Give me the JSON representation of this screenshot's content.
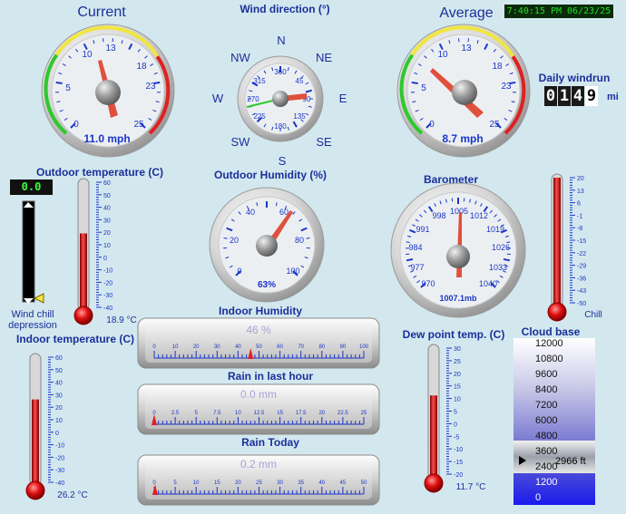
{
  "clock": "7:40:15 PM 06/23/25",
  "current": {
    "title": "Current",
    "readout": "11.0 mph",
    "ticks": [
      "0",
      "5",
      "10",
      "13",
      "18",
      "23",
      "25"
    ]
  },
  "average": {
    "title": "Average",
    "readout": "8.7 mph",
    "ticks": [
      "0",
      "5",
      "10",
      "13",
      "18",
      "23",
      "25"
    ]
  },
  "wind_direction": {
    "title": "Wind direction (°)",
    "compass": {
      "n": "N",
      "ne": "NE",
      "e": "E",
      "se": "SE",
      "s": "S",
      "sw": "SW",
      "w": "W",
      "nw": "NW"
    },
    "ticks": [
      "360",
      "45",
      "90",
      "135",
      "180",
      "225",
      "270",
      "315"
    ]
  },
  "daily_windrun": {
    "title": "Daily windrun",
    "digits": [
      "0",
      "1",
      "4",
      "9"
    ],
    "unit": "mi"
  },
  "outdoor_temp": {
    "title": "Outdoor temperature (C)",
    "readout": "18.9 °C",
    "scale": [
      "60",
      "50",
      "40",
      "30",
      "20",
      "10",
      "0",
      "-10",
      "-20",
      "-30",
      "-40"
    ],
    "value": 18.9
  },
  "wind_chill": {
    "lcd": "0.0",
    "label_line1": "Wind chill",
    "label_line2": "depression"
  },
  "outdoor_humidity": {
    "title": "Outdoor Humidity (%)",
    "readout": "63%",
    "ticks": [
      "0",
      "20",
      "40",
      "60",
      "80",
      "100"
    ]
  },
  "barometer": {
    "title": "Barometer",
    "readout": "1007.1mb",
    "ticks": [
      "970",
      "977",
      "984",
      "991",
      "998",
      "1005",
      "1012",
      "1019",
      "1026",
      "1033",
      "1040"
    ]
  },
  "chill": {
    "label": "Chill",
    "scale": [
      "20",
      "13",
      "6",
      "-1",
      "-8",
      "-15",
      "-22",
      "-29",
      "-36",
      "-43",
      "-50"
    ]
  },
  "indoor_temp": {
    "title": "Indoor temperature (C)",
    "readout": "26.2 °C",
    "scale": [
      "60",
      "50",
      "40",
      "30",
      "20",
      "10",
      "0",
      "-10",
      "-20",
      "-30",
      "-40"
    ],
    "value": 26.2
  },
  "indoor_humidity": {
    "title": "Indoor Humidity",
    "readout": "46 %",
    "value": 46,
    "ticks": [
      "0",
      "10",
      "20",
      "30",
      "40",
      "50",
      "60",
      "70",
      "80",
      "90",
      "100"
    ]
  },
  "rain_hour": {
    "title": "Rain in last hour",
    "readout": "0.0 mm",
    "value": 0,
    "ticks": [
      "0",
      "2.5",
      "5",
      "7.5",
      "10",
      "12.5",
      "15",
      "17.5",
      "20",
      "22.5",
      "25"
    ]
  },
  "rain_today": {
    "title": "Rain Today",
    "readout": "0.2 mm",
    "value": 0.2,
    "ticks": [
      "0",
      "5",
      "10",
      "15",
      "20",
      "25",
      "30",
      "35",
      "40",
      "45",
      "50"
    ]
  },
  "dew_point": {
    "title": "Dew point temp. (C)",
    "readout": "11.7 °C",
    "scale": [
      "30",
      "25",
      "20",
      "15",
      "10",
      "5",
      "0",
      "-5",
      "-10",
      "-15",
      "-20"
    ],
    "value": 11.7
  },
  "cloud_base": {
    "title": "Cloud base",
    "value": "2966 ft",
    "scale": [
      "12000",
      "10800",
      "9600",
      "8400",
      "7200",
      "6000",
      "4800",
      "3600",
      "2400",
      "1200",
      "0"
    ]
  },
  "colors": {
    "label": "#1b2f9b",
    "tick": "#1a35c8",
    "needle": "#e0503c",
    "thermo": "#c01818",
    "bezel": "#b8b8b8"
  }
}
